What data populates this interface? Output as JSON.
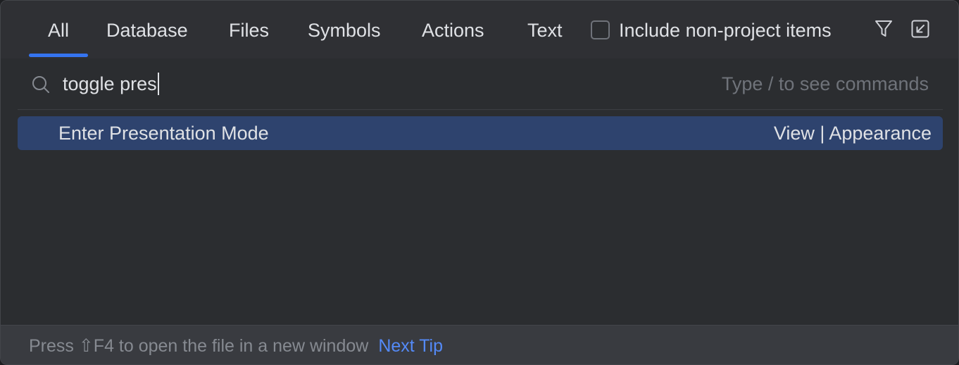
{
  "tabs": [
    {
      "label": "All",
      "active": true
    },
    {
      "label": "Database"
    },
    {
      "label": "Files"
    },
    {
      "label": "Symbols"
    },
    {
      "label": "Actions"
    },
    {
      "label": "Text"
    }
  ],
  "include_checkbox": {
    "label": "Include non-project items",
    "checked": false
  },
  "toolbar_icons": {
    "filter": "filter-icon",
    "collapse": "collapse-window-icon"
  },
  "search": {
    "value": "toggle pres",
    "hint": "Type / to see commands",
    "icon": "search-icon"
  },
  "results": [
    {
      "name": "Enter Presentation Mode",
      "location": "View | Appearance",
      "selected": true
    }
  ],
  "footer": {
    "tip_text": "Press ⇧F4 to open the file in a new window",
    "next_tip_label": "Next Tip"
  },
  "colors": {
    "accent": "#3574f0",
    "selection": "#2e436e",
    "link": "#548af7",
    "background": "#2b2d30",
    "footer_bg": "#393b40"
  }
}
